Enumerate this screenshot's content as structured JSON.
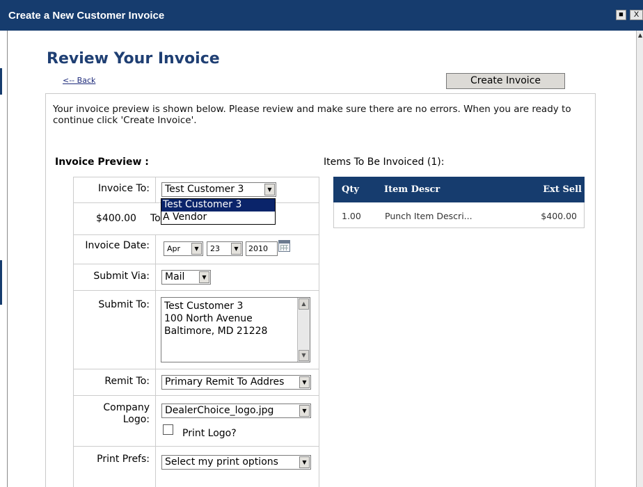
{
  "window": {
    "title": "Create a New Customer Invoice",
    "minimize_icon": "minimize-icon",
    "close_icon": "close-icon",
    "close_glyph": "X"
  },
  "page": {
    "heading": "Review Your Invoice",
    "back_link": "<-- Back",
    "create_button": "Create Invoice",
    "intro": "Your invoice preview is shown below. Please review and make sure there are no errors. When you are ready to continue click 'Create Invoice'."
  },
  "preview": {
    "label": "Invoice Preview :",
    "invoice_to": {
      "label": "Invoice To:",
      "selected": "Test Customer 3",
      "options": [
        "Test Customer 3",
        "A Vendor"
      ],
      "highlighted_option": "Test Customer 3"
    },
    "amount": {
      "value": "$400.00",
      "suffix": "To"
    },
    "invoice_date": {
      "label": "Invoice Date:",
      "month": "Apr",
      "day": "23",
      "year": "2010",
      "icon": "calendar-icon"
    },
    "submit_via": {
      "label": "Submit Via:",
      "selected": "Mail"
    },
    "submit_to": {
      "label": "Submit To:",
      "lines": [
        "Test Customer 3",
        "100 North Avenue",
        "Baltimore, MD 21228"
      ]
    },
    "remit_to": {
      "label": "Remit To:",
      "selected": "Primary Remit To Addres"
    },
    "company_logo": {
      "label_line1": "Company",
      "label_line2": "Logo:",
      "selected": "DealerChoice_logo.jpg",
      "print_logo_label": "Print Logo?",
      "print_logo_checked": false
    },
    "print_prefs": {
      "label": "Print Prefs:",
      "selected": "Select my print options"
    }
  },
  "items": {
    "label": "Items To Be Invoiced (1):",
    "columns": [
      "Qty",
      "Item Descr",
      "Ext Sell"
    ],
    "rows": [
      {
        "qty": "1.00",
        "descr": "Punch Item Descri...",
        "ext_sell": "$400.00"
      }
    ]
  },
  "colors": {
    "title_bar": "#163c6e",
    "heading": "#1f3f73",
    "selection_highlight": "#0a246a"
  }
}
